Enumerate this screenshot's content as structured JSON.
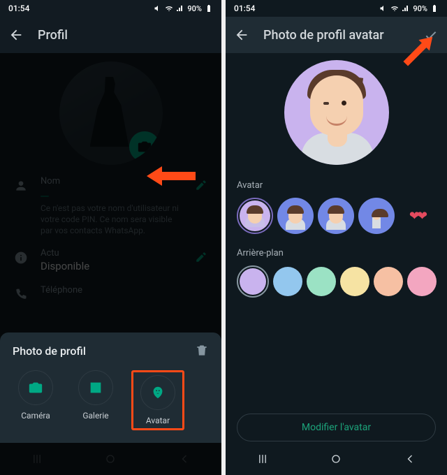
{
  "status": {
    "time": "01:54",
    "battery": "90%"
  },
  "left": {
    "header_title": "Profil",
    "name_label": "Nom",
    "name_value": " ",
    "name_hint": "Ce n'est pas votre nom d'utilisateur ni votre code PIN. Ce nom sera visible par vos contacts WhatsApp.",
    "status_label": "Actu",
    "status_value": "Disponible",
    "phone_label": "Téléphone",
    "sheet_title": "Photo de profil",
    "actions": {
      "camera": "Caméra",
      "gallery": "Galerie",
      "avatar": "Avatar"
    }
  },
  "right": {
    "header_title": "Photo de profil avatar",
    "avatar_label": "Avatar",
    "background_label": "Arrière-plan",
    "modify_label": "Modifier l'avatar",
    "bg_colors": [
      "#c9b3ee",
      "#93c7ee",
      "#9be2c4",
      "#f6e3a3",
      "#f6c0a3",
      "#f3a6c0"
    ]
  }
}
